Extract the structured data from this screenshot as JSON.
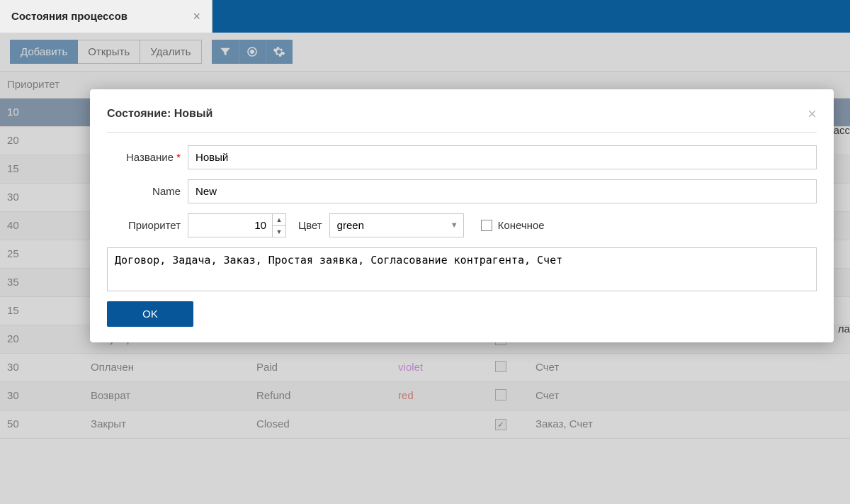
{
  "tab": {
    "title": "Состояния процессов"
  },
  "toolbar": {
    "add": "Добавить",
    "open": "Открыть",
    "delete": "Удалить"
  },
  "icons": {
    "filter": "filter-icon",
    "target": "target-icon",
    "gear": "gear-icon"
  },
  "columns": {
    "priority": "Приоритет"
  },
  "rows": [
    {
      "priority": "10",
      "nazv": "",
      "name": "",
      "color": "",
      "final": false,
      "classes": "",
      "selected": true
    },
    {
      "priority": "20",
      "nazv": "",
      "name": "",
      "color": "",
      "final": false,
      "classes": ""
    },
    {
      "priority": "15",
      "nazv": "",
      "name": "",
      "color": "",
      "final": false,
      "classes": ""
    },
    {
      "priority": "30",
      "nazv": "",
      "name": "",
      "color": "",
      "final": false,
      "classes": ""
    },
    {
      "priority": "40",
      "nazv": "",
      "name": "",
      "color": "",
      "final": false,
      "classes": ""
    },
    {
      "priority": "25",
      "nazv": "",
      "name": "",
      "color": "",
      "final": false,
      "classes": ""
    },
    {
      "priority": "35",
      "nazv": "",
      "name": "",
      "color": "",
      "final": false,
      "classes": ""
    },
    {
      "priority": "15",
      "nazv": "",
      "name": "",
      "color": "",
      "final": false,
      "classes": ""
    },
    {
      "priority": "20",
      "nazv": "Аннулирован",
      "name": "Cancelled",
      "color": "",
      "final": true,
      "classes": "Счет"
    },
    {
      "priority": "30",
      "nazv": "Оплачен",
      "name": "Paid",
      "color": "violet",
      "final": false,
      "classes": "Счет"
    },
    {
      "priority": "30",
      "nazv": "Возврат",
      "name": "Refund",
      "color": "red",
      "final": false,
      "classes": "Счет"
    },
    {
      "priority": "50",
      "nazv": "Закрыт",
      "name": "Closed",
      "color": "",
      "final": true,
      "classes": "Заказ, Счет"
    }
  ],
  "edge": {
    "top_fragment": "асс",
    "mid_fragment": "ла"
  },
  "dialog": {
    "title": "Состояние: Новый",
    "labels": {
      "nazvanie": "Название",
      "name": "Name",
      "priority": "Приоритет",
      "color": "Цвет",
      "final": "Конечное"
    },
    "values": {
      "nazvanie": "Новый",
      "name": "New",
      "priority": "10",
      "color": "green",
      "final": false,
      "classes": "Договор, Задача, Заказ, Простая заявка, Согласование контрагента, Счет"
    },
    "ok": "OK"
  }
}
